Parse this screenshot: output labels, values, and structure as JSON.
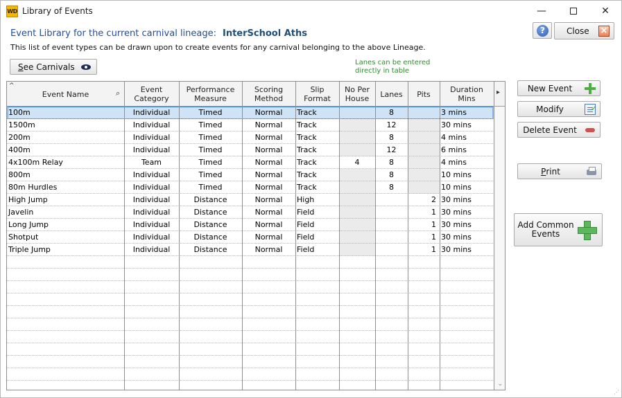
{
  "window": {
    "app_icon_text": "WD",
    "title": "Library of Events",
    "minimize_glyph": "—",
    "close_glyph": "✕"
  },
  "header": {
    "heading": "Event Library for the current carnival lineage:",
    "lineage_name": "InterSchool Aths",
    "description": "This list of event types can be drawn upon to create events for any carnival belonging to the above Lineage."
  },
  "buttons": {
    "help_glyph": "?",
    "close_label": "Close",
    "see_carnivals_u": "S",
    "see_carnivals_rest": "ee Carnivals",
    "new_event": "New Event",
    "modify": "Modify",
    "delete_event": "Delete Event",
    "print_u": "P",
    "print_rest": "rint",
    "add_common_line1": "Add Common",
    "add_common_line2": "Events"
  },
  "note": {
    "line1": "Lanes can be entered",
    "line2": "directly in table"
  },
  "table": {
    "sort_indicator": "^",
    "search_glyph": "⌕",
    "scroll_right_glyph": "▸",
    "scroll_down_glyph": "⌄",
    "columns": [
      {
        "key": "name",
        "label1": "Event Name",
        "label2": "",
        "align": "left"
      },
      {
        "key": "category",
        "label1": "Event",
        "label2": "Category",
        "align": "center"
      },
      {
        "key": "measure",
        "label1": "Performance",
        "label2": "Measure",
        "align": "center"
      },
      {
        "key": "scoring",
        "label1": "Scoring",
        "label2": "Method",
        "align": "center"
      },
      {
        "key": "slip",
        "label1": "Slip",
        "label2": "Format",
        "align": "left"
      },
      {
        "key": "per_house",
        "label1": "No Per",
        "label2": "House",
        "align": "center"
      },
      {
        "key": "lanes",
        "label1": "Lanes",
        "label2": "",
        "align": "center"
      },
      {
        "key": "pits",
        "label1": "Pits",
        "label2": "",
        "align": "right"
      },
      {
        "key": "duration",
        "label1": "Duration",
        "label2": "Mins",
        "align": "left"
      }
    ],
    "rows": [
      {
        "name": "100m",
        "category": "Individual",
        "measure": "Timed",
        "scoring": "Normal",
        "slip": "Track",
        "per_house": "",
        "lanes": "8",
        "pits": "",
        "duration": "3 mins",
        "selected": true
      },
      {
        "name": "1500m",
        "category": "Individual",
        "measure": "Timed",
        "scoring": "Normal",
        "slip": "Track",
        "per_house": "",
        "lanes": "12",
        "pits": "",
        "duration": "30 mins"
      },
      {
        "name": "200m",
        "category": "Individual",
        "measure": "Timed",
        "scoring": "Normal",
        "slip": "Track",
        "per_house": "",
        "lanes": "8",
        "pits": "",
        "duration": "4 mins"
      },
      {
        "name": "400m",
        "category": "Individual",
        "measure": "Timed",
        "scoring": "Normal",
        "slip": "Track",
        "per_house": "",
        "lanes": "12",
        "pits": "",
        "duration": "6 mins"
      },
      {
        "name": "4x100m Relay",
        "category": "Team",
        "measure": "Timed",
        "scoring": "Normal",
        "slip": "Track",
        "per_house": "4",
        "lanes": "8",
        "pits": "",
        "duration": "4 mins"
      },
      {
        "name": "800m",
        "category": "Individual",
        "measure": "Timed",
        "scoring": "Normal",
        "slip": "Track",
        "per_house": "",
        "lanes": "8",
        "pits": "",
        "duration": "10 mins"
      },
      {
        "name": "80m Hurdles",
        "category": "Individual",
        "measure": "Timed",
        "scoring": "Normal",
        "slip": "Track",
        "per_house": "",
        "lanes": "8",
        "pits": "",
        "duration": "10 mins"
      },
      {
        "name": "High Jump",
        "category": "Individual",
        "measure": "Distance",
        "scoring": "Normal",
        "slip": "High",
        "per_house": "",
        "lanes": "",
        "pits": "2",
        "duration": "30 mins"
      },
      {
        "name": "Javelin",
        "category": "Individual",
        "measure": "Distance",
        "scoring": "Normal",
        "slip": "Field",
        "per_house": "",
        "lanes": "",
        "pits": "1",
        "duration": "30 mins"
      },
      {
        "name": "Long Jump",
        "category": "Individual",
        "measure": "Distance",
        "scoring": "Normal",
        "slip": "Field",
        "per_house": "",
        "lanes": "",
        "pits": "1",
        "duration": "30 mins"
      },
      {
        "name": "Shotput",
        "category": "Individual",
        "measure": "Distance",
        "scoring": "Normal",
        "slip": "Field",
        "per_house": "",
        "lanes": "",
        "pits": "1",
        "duration": "30 mins"
      },
      {
        "name": "Triple Jump",
        "category": "Individual",
        "measure": "Distance",
        "scoring": "Normal",
        "slip": "Field",
        "per_house": "",
        "lanes": "",
        "pits": "1",
        "duration": "30 mins"
      }
    ]
  },
  "colors": {
    "selected_row": "#cfe3f7",
    "selected_border": "#3c7fd1",
    "disabled_cell": "#ebebeb",
    "heading": "#1f4e9c",
    "note": "#2e8b2e"
  }
}
